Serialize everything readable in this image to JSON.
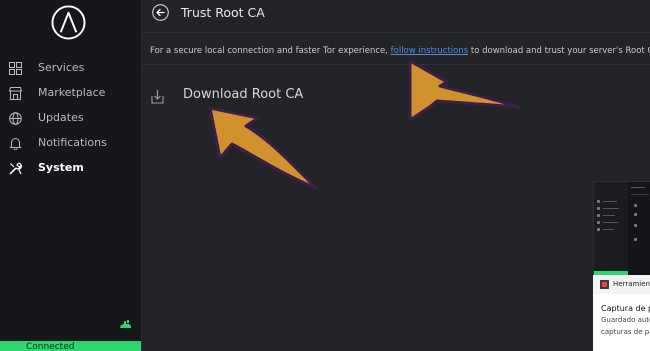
{
  "sidebar": {
    "items": [
      {
        "label": "Services",
        "icon": "grid-icon"
      },
      {
        "label": "Marketplace",
        "icon": "store-icon"
      },
      {
        "label": "Updates",
        "icon": "globe-icon"
      },
      {
        "label": "Notifications",
        "icon": "bell-icon"
      },
      {
        "label": "System",
        "icon": "tools-icon",
        "active": true
      }
    ],
    "status_label": "Connected"
  },
  "header": {
    "title": "Trust Root CA"
  },
  "main": {
    "description_before": "For a secure local connection and faster Tor experience, ",
    "description_link": "follow instructions",
    "description_after": " to download and trust your server's Root Certificate Autho",
    "download_label": "Download Root CA"
  },
  "toast": {
    "app_name": "Herramienta",
    "title": "Captura de pa",
    "body_line1": "Guardado auto",
    "body_line2": "capturas de pa"
  },
  "colors": {
    "accent_green": "#2ed573",
    "link_blue": "#4d8fe0",
    "arrow_fill": "#d2912f",
    "arrow_outline": "#3b1f47",
    "sidebar_bg": "#16171a",
    "main_bg": "#232428"
  }
}
